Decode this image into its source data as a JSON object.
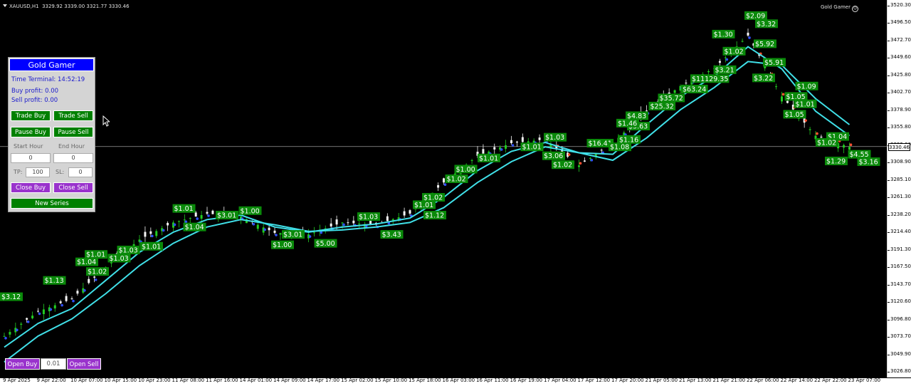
{
  "symbol_bar": {
    "symbol": "XAUUSD,H1",
    "ohlc": "3329.92 3339.00 3321.77 3330.46"
  },
  "ea_name": "Gold Gamer",
  "price_axis": {
    "ticks": [
      "3520.30",
      "3496.50",
      "3472.70",
      "3449.60",
      "3425.80",
      "3402.70",
      "3378.90",
      "3355.80",
      "3332.00",
      "3308.90",
      "3285.10",
      "3261.30",
      "3238.20",
      "3214.40",
      "3191.30",
      "3167.50",
      "3143.70",
      "3120.60",
      "3096.80",
      "3073.70",
      "3049.90",
      "3026.80"
    ],
    "current_price": "3330.46"
  },
  "time_axis": {
    "ticks": [
      "9 Apr 2025",
      "9 Apr 22:00",
      "10 Apr 07:00",
      "10 Apr 15:00",
      "10 Apr 23:00",
      "11 Apr 08:00",
      "11 Apr 16:00",
      "14 Apr 01:00",
      "14 Apr 09:00",
      "14 Apr 17:00",
      "15 Apr 02:00",
      "15 Apr 10:00",
      "15 Apr 18:00",
      "16 Apr 03:00",
      "16 Apr 11:00",
      "16 Apr 19:00",
      "17 Apr 04:00",
      "17 Apr 12:00",
      "17 Apr 20:00",
      "21 Apr 05:00",
      "21 Apr 13:00",
      "21 Apr 21:00",
      "22 Apr 06:00",
      "22 Apr 14:00",
      "22 Apr 22:00",
      "23 Apr 07:00"
    ]
  },
  "panel": {
    "title": "Gold Gamer",
    "time_terminal": "Time Terminal: 14:52:19",
    "buy_profit": "Buy profit: 0.00",
    "sell_profit": "Sell profit: 0.00",
    "trade_buy": "Trade Buy",
    "trade_sell": "Trade Sell",
    "pause_buy": "Pause Buy",
    "pause_sell": "Pause Sell",
    "start_hour_label": "Start Hour",
    "end_hour_label": "End Hour",
    "start_hour_value": "0",
    "end_hour_value": "0",
    "tp_label": "TP:",
    "tp_value": "100",
    "sl_label": "SL:",
    "sl_value": "0",
    "close_buy": "Close Buy",
    "close_sell": "Close Sell",
    "new_series": "New Series"
  },
  "bottom": {
    "open_buy": "Open Buy",
    "lot": "0.01",
    "open_sell": "Open Sell"
  },
  "colors": {
    "ma": "#40e0e8",
    "candle": "#f5f5f5",
    "up_candle": "#22cc22",
    "buy_marker": "#3050ff",
    "sell_marker": "#ff5030",
    "label_bg": "#0a8a0a",
    "panel_title_bg": "#0000ff",
    "green_button": "#008000",
    "purple_button": "#9932cc"
  },
  "chart_data": {
    "type": "candlestick",
    "x": [
      "9 Apr 2025",
      "9 Apr 22:00",
      "10 Apr 07:00",
      "10 Apr 15:00",
      "10 Apr 23:00",
      "11 Apr 08:00",
      "11 Apr 16:00",
      "14 Apr 01:00",
      "14 Apr 09:00",
      "14 Apr 17:00",
      "15 Apr 02:00",
      "15 Apr 10:00",
      "15 Apr 18:00",
      "16 Apr 03:00",
      "16 Apr 11:00",
      "16 Apr 19:00",
      "17 Apr 04:00",
      "17 Apr 12:00",
      "17 Apr 20:00",
      "21 Apr 05:00",
      "21 Apr 13:00",
      "21 Apr 21:00",
      "22 Apr 06:00",
      "22 Apr 14:00",
      "22 Apr 22:00",
      "23 Apr 07:00"
    ],
    "close": [
      3075,
      3108,
      3125,
      3168,
      3205,
      3228,
      3240,
      3236,
      3214,
      3212,
      3228,
      3225,
      3240,
      3282,
      3318,
      3335,
      3340,
      3305,
      3335,
      3378,
      3412,
      3436,
      3480,
      3398,
      3345,
      3330
    ],
    "ma_fast": [
      3060,
      3092,
      3112,
      3150,
      3188,
      3215,
      3232,
      3238,
      3222,
      3215,
      3222,
      3226,
      3234,
      3262,
      3298,
      3324,
      3336,
      3322,
      3320,
      3360,
      3398,
      3425,
      3465,
      3435,
      3378,
      3345
    ],
    "ma_slow": [
      3040,
      3075,
      3098,
      3132,
      3170,
      3200,
      3222,
      3232,
      3225,
      3216,
      3218,
      3222,
      3228,
      3248,
      3282,
      3310,
      3330,
      3322,
      3312,
      3342,
      3380,
      3410,
      3445,
      3440,
      3395,
      3360
    ],
    "ylim": [
      3026.8,
      3520.3
    ],
    "current_price": 3330.46,
    "profit_labels": [
      {
        "text": "$3.12",
        "x": "9 Apr 2025",
        "y": 3128
      },
      {
        "text": "$1.13",
        "x": "9 Apr 22:00",
        "y": 3150
      },
      {
        "text": "$1.02",
        "x": "10 Apr 07:00",
        "y": 3162
      },
      {
        "text": "$1.04",
        "x": "10 Apr 07:00",
        "y": 3175
      },
      {
        "text": "$1.01",
        "x": "10 Apr 07:00",
        "y": 3185
      },
      {
        "text": "$1.03",
        "x": "10 Apr 15:00",
        "y": 3180
      },
      {
        "text": "$1.03",
        "x": "10 Apr 15:00",
        "y": 3191
      },
      {
        "text": "$1.01",
        "x": "10 Apr 23:00",
        "y": 3196
      },
      {
        "text": "$1.04",
        "x": "11 Apr 08:00",
        "y": 3222
      },
      {
        "text": "$1.01",
        "x": "11 Apr 08:00",
        "y": 3247
      },
      {
        "text": "$3.01",
        "x": "11 Apr 16:00",
        "y": 3238
      },
      {
        "text": "$1.00",
        "x": "14 Apr 01:00",
        "y": 3244
      },
      {
        "text": "$3.01",
        "x": "14 Apr 09:00",
        "y": 3212
      },
      {
        "text": "$1.00",
        "x": "14 Apr 09:00",
        "y": 3198
      },
      {
        "text": "$5.00",
        "x": "14 Apr 17:00",
        "y": 3200
      },
      {
        "text": "$1.03",
        "x": "15 Apr 02:00",
        "y": 3236
      },
      {
        "text": "$3.43",
        "x": "15 Apr 10:00",
        "y": 3212
      },
      {
        "text": "$1.12",
        "x": "15 Apr 18:00",
        "y": 3238
      },
      {
        "text": "$1.01",
        "x": "15 Apr 18:00",
        "y": 3252
      },
      {
        "text": "$1.02",
        "x": "15 Apr 18:00",
        "y": 3262
      },
      {
        "text": "$1.02",
        "x": "16 Apr 03:00",
        "y": 3287
      },
      {
        "text": "$1.00",
        "x": "16 Apr 03:00",
        "y": 3300
      },
      {
        "text": "$1.01",
        "x": "16 Apr 11:00",
        "y": 3315
      },
      {
        "text": "$1.01",
        "x": "16 Apr 19:00",
        "y": 3330
      },
      {
        "text": "$1.03",
        "x": "17 Apr 04:00",
        "y": 3343
      },
      {
        "text": "$16.41",
        "x": "17 Apr 12:00",
        "y": 3335
      },
      {
        "text": "$3.06",
        "x": "17 Apr 04:00",
        "y": 3318
      },
      {
        "text": "$1.02",
        "x": "17 Apr 04:00",
        "y": 3306
      },
      {
        "text": "$1.08",
        "x": "17 Apr 20:00",
        "y": 3330
      },
      {
        "text": "$1.16",
        "x": "17 Apr 20:00",
        "y": 3340
      },
      {
        "text": "$3.63",
        "x": "17 Apr 20:00",
        "y": 3358
      },
      {
        "text": "$1.46",
        "x": "17 Apr 20:00",
        "y": 3362
      },
      {
        "text": "$4.83",
        "x": "17 Apr 20:00",
        "y": 3372
      },
      {
        "text": "$25.32",
        "x": "21 Apr 05:00",
        "y": 3385
      },
      {
        "text": "$35.72",
        "x": "21 Apr 05:00",
        "y": 3396
      },
      {
        "text": "$63.24",
        "x": "21 Apr 13:00",
        "y": 3408
      },
      {
        "text": "$11129.35",
        "x": "21 Apr 13:00",
        "y": 3422
      },
      {
        "text": "$3.21",
        "x": "21 Apr 21:00",
        "y": 3434
      },
      {
        "text": "$1.02",
        "x": "21 Apr 21:00",
        "y": 3459
      },
      {
        "text": "$1.30",
        "x": "21 Apr 21:00",
        "y": 3482
      },
      {
        "text": "$3.32",
        "x": "22 Apr 06:00",
        "y": 3496
      },
      {
        "text": "$2.09",
        "x": "22 Apr 06:00",
        "y": 3507
      },
      {
        "text": "$5.92",
        "x": "22 Apr 06:00",
        "y": 3469
      },
      {
        "text": "$5.91",
        "x": "22 Apr 06:00",
        "y": 3444
      },
      {
        "text": "$3.22",
        "x": "22 Apr 06:00",
        "y": 3423
      },
      {
        "text": "$1.09",
        "x": "22 Apr 14:00",
        "y": 3412
      },
      {
        "text": "$1.05",
        "x": "22 Apr 14:00",
        "y": 3398
      },
      {
        "text": "$1.01",
        "x": "22 Apr 14:00",
        "y": 3388
      },
      {
        "text": "$1.05",
        "x": "22 Apr 14:00",
        "y": 3374
      },
      {
        "text": "$1.04",
        "x": "22 Apr 22:00",
        "y": 3344
      },
      {
        "text": "$1.02",
        "x": "22 Apr 22:00",
        "y": 3336
      },
      {
        "text": "$1.29",
        "x": "22 Apr 22:00",
        "y": 3311
      },
      {
        "text": "$4.55",
        "x": "23 Apr 07:00",
        "y": 3320
      },
      {
        "text": "$3.16",
        "x": "23 Apr 07:00",
        "y": 3310
      }
    ]
  }
}
